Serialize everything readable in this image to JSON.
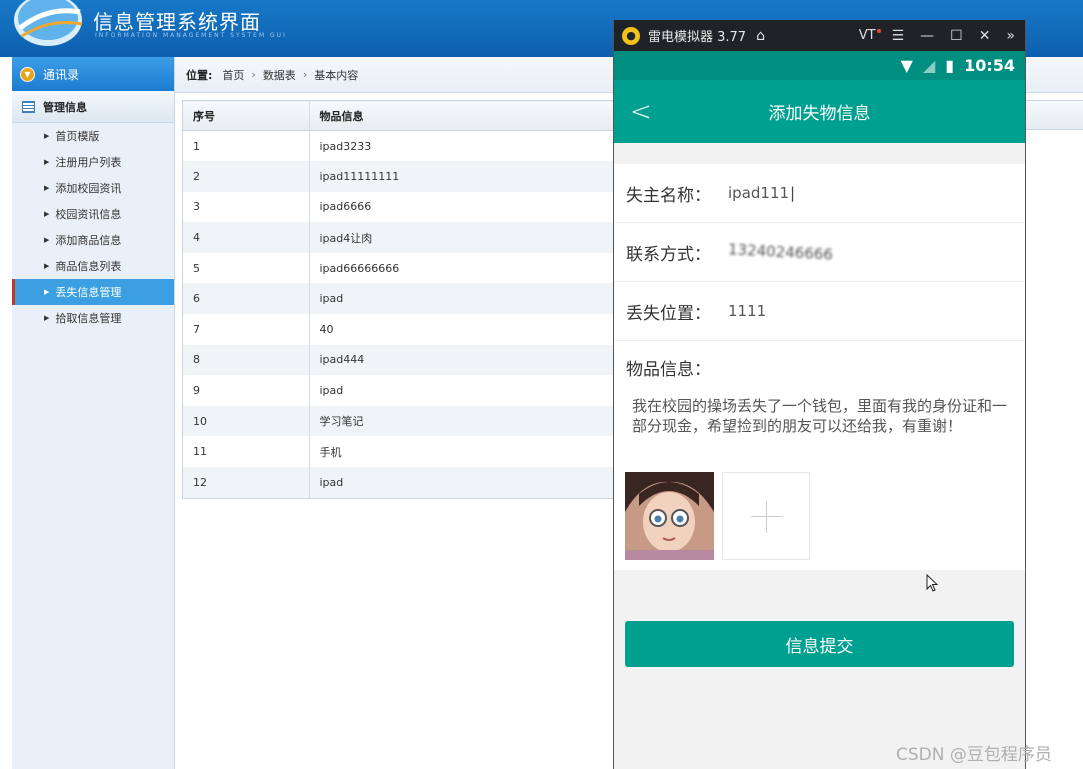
{
  "header": {
    "title": "信息管理系统界面",
    "subtitle": "INFORMATION MANAGEMENT SYSTEM GUI"
  },
  "sidebar": {
    "top_label": "通讯录",
    "section_label": "管理信息",
    "items": [
      {
        "label": "首页模版"
      },
      {
        "label": "注册用户列表"
      },
      {
        "label": "添加校园资讯"
      },
      {
        "label": "校园资讯信息"
      },
      {
        "label": "添加商品信息"
      },
      {
        "label": "商品信息列表"
      },
      {
        "label": "丢失信息管理",
        "active": true
      },
      {
        "label": "拾取信息管理"
      }
    ]
  },
  "breadcrumb": {
    "label": "位置:",
    "items": [
      "首页",
      "数据表",
      "基本内容"
    ]
  },
  "table": {
    "headers": [
      "序号",
      "物品信息"
    ],
    "rows": [
      [
        "1",
        "ipad3233"
      ],
      [
        "2",
        "ipad11111111"
      ],
      [
        "3",
        "ipad6666"
      ],
      [
        "4",
        "ipad4让肉"
      ],
      [
        "5",
        "ipad66666666"
      ],
      [
        "6",
        "ipad"
      ],
      [
        "7",
        "40"
      ],
      [
        "8",
        "ipad444"
      ],
      [
        "9",
        "ipad"
      ],
      [
        "10",
        "学习笔记"
      ],
      [
        "11",
        "手机"
      ],
      [
        "12",
        "ipad"
      ]
    ]
  },
  "emulator": {
    "window_title": "雷电模拟器 3.77",
    "vt_label": "VT",
    "clock": "10:54",
    "app_title": "添加失物信息",
    "form": {
      "owner_label": "失主名称：",
      "owner_value": "ipad111",
      "contact_label": "联系方式：",
      "contact_value": "13240246666",
      "location_label": "丢失位置：",
      "location_value": "1111",
      "desc_label": "物品信息：",
      "desc_value": "我在校园的操场丢失了一个钱包，里面有我的身份证和一部分现金，希望捡到的朋友可以还给我，有重谢！"
    },
    "submit_label": "信息提交"
  },
  "watermark": "CSDN @豆包程序员",
  "colors": {
    "header_blue": "#0e5fae",
    "app_teal": "#00a091",
    "active_item": "#3b9fe2"
  }
}
